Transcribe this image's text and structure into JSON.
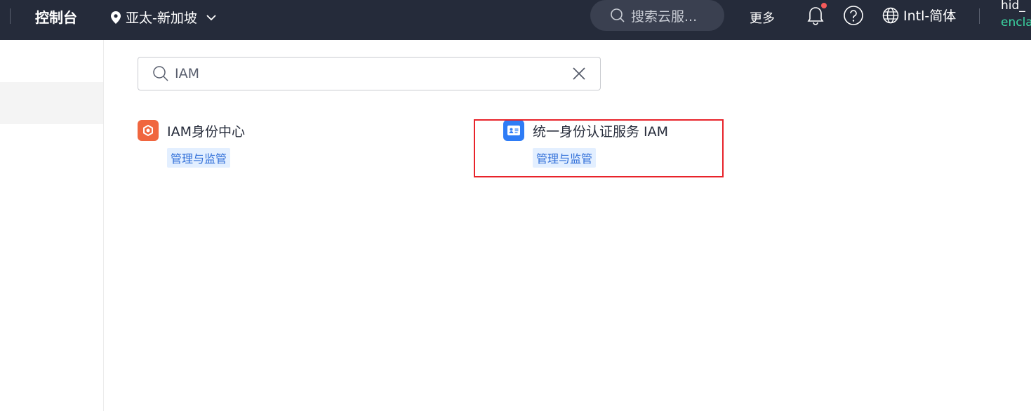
{
  "header": {
    "console_title": "控制台",
    "region": "亚太-新加坡",
    "search_placeholder": "搜索云服...",
    "more_label": "更多",
    "language": "Intl-简体",
    "user_line1": "hid_",
    "user_line2": "encla",
    "bell_badge_color": "#f55a5a"
  },
  "search": {
    "value": "IAM"
  },
  "results": [
    {
      "name": "IAM身份中心",
      "tag": "管理与监管",
      "icon": "iam-identity-center-icon",
      "icon_color": "#f0663f"
    },
    {
      "name": "统一身份认证服务 IAM",
      "tag": "管理与监管",
      "icon": "id-card-icon",
      "icon_color": "#2e7cf6"
    }
  ],
  "colors": {
    "topbar_bg": "#252b3a",
    "highlight_border": "#e8232a",
    "tag_bg": "#e3efff",
    "tag_text": "#2f6ed8"
  }
}
